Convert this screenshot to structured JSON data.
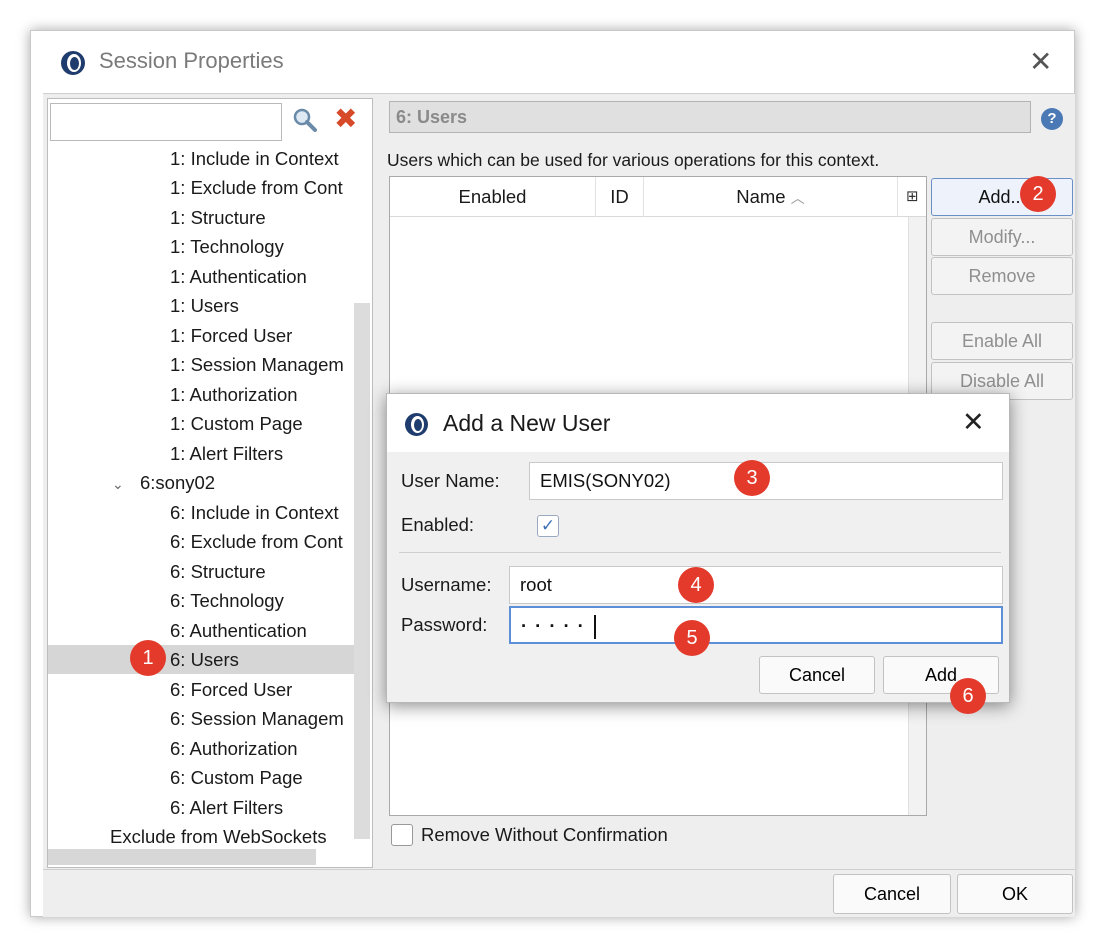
{
  "window": {
    "title": "Session Properties",
    "icon": "app-logo-icon",
    "close_icon": "close-icon"
  },
  "tree": {
    "search_value": "",
    "search_icon": "search-icon",
    "clear_icon": "clear-x-icon",
    "items": [
      {
        "label": "1: Include in Context",
        "indent": 2
      },
      {
        "label": "1: Exclude from Cont",
        "indent": 2
      },
      {
        "label": "1: Structure",
        "indent": 2
      },
      {
        "label": "1: Technology",
        "indent": 2
      },
      {
        "label": "1: Authentication",
        "indent": 2
      },
      {
        "label": "1: Users",
        "indent": 2
      },
      {
        "label": "1: Forced User",
        "indent": 2
      },
      {
        "label": "1: Session Managem",
        "indent": 2
      },
      {
        "label": "1: Authorization",
        "indent": 2
      },
      {
        "label": "1: Custom Page",
        "indent": 2
      },
      {
        "label": "1: Alert Filters",
        "indent": 2
      },
      {
        "label": "6:sony02",
        "indent": 1
      },
      {
        "label": "6: Include in Context",
        "indent": 2
      },
      {
        "label": "6: Exclude from Cont",
        "indent": 2
      },
      {
        "label": "6: Structure",
        "indent": 2
      },
      {
        "label": "6: Technology",
        "indent": 2
      },
      {
        "label": "6: Authentication",
        "indent": 2
      },
      {
        "label": "6: Users",
        "indent": 2
      },
      {
        "label": "6: Forced User",
        "indent": 2
      },
      {
        "label": "6: Session Managem",
        "indent": 2
      },
      {
        "label": "6: Authorization",
        "indent": 2
      },
      {
        "label": "6: Custom Page",
        "indent": 2
      },
      {
        "label": "6: Alert Filters",
        "indent": 2
      },
      {
        "label": "Exclude from WebSockets",
        "indent": 0
      }
    ],
    "selected": "6: Users"
  },
  "panel": {
    "header": "6: Users",
    "description": "Users which can be used for various operations for this context.",
    "columns": [
      "Enabled",
      "ID",
      "Name"
    ],
    "sort_column": "Name",
    "sort_icon": "sort-ascending-icon",
    "buttons": {
      "add": "Add...",
      "modify": "Modify...",
      "remove": "Remove",
      "enable_all": "Enable All",
      "disable_all": "Disable All"
    },
    "remove_without_confirmation": "Remove Without Confirmation"
  },
  "footer": {
    "cancel": "Cancel",
    "ok": "OK"
  },
  "dialog": {
    "title": "Add a New User",
    "user_name_label": "User Name:",
    "user_name_value": "EMIS(SONY02)",
    "enabled_label": "Enabled:",
    "enabled_checked": true,
    "username_label": "Username:",
    "username_value": "root",
    "password_label": "Password:",
    "password_value": "·····",
    "cancel": "Cancel",
    "add": "Add"
  },
  "badges": [
    "1",
    "2",
    "3",
    "4",
    "5",
    "6"
  ],
  "accent_color": "#e33a2c"
}
